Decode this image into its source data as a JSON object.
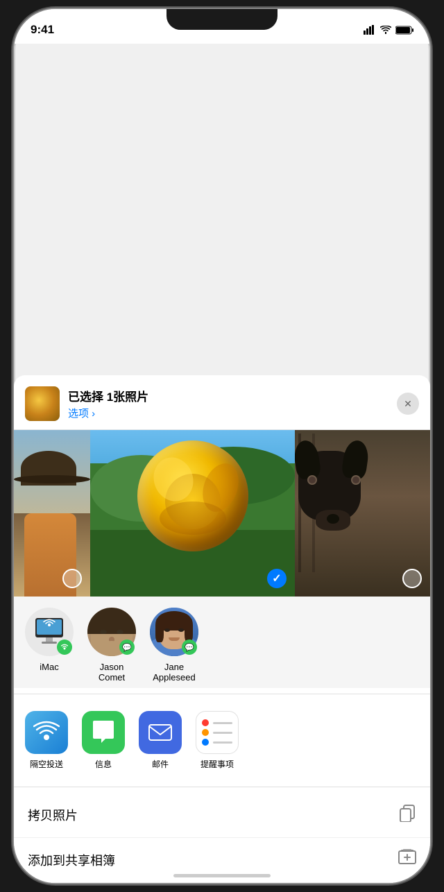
{
  "statusBar": {
    "time": "9:41"
  },
  "photoHeader": {
    "title": "已选择 1张照片",
    "options": "选项 ›",
    "closeLabel": "×"
  },
  "photos": {
    "selected": 1,
    "items": [
      {
        "id": "left",
        "type": "person-hat"
      },
      {
        "id": "center",
        "type": "yellow-rose",
        "selected": true
      },
      {
        "id": "right",
        "type": "dog"
      }
    ]
  },
  "airdrop": {
    "people": [
      {
        "id": "imac",
        "name": "iMac",
        "type": "device"
      },
      {
        "id": "jason",
        "name": "Jason\nComet",
        "nameDisplay": "Jason Comet",
        "type": "person"
      },
      {
        "id": "jane",
        "name": "Jane\nAppleseed",
        "nameDisplay": "Jane Appleseed",
        "type": "person"
      }
    ]
  },
  "apps": [
    {
      "id": "airdrop",
      "label": "隔空投送"
    },
    {
      "id": "messages",
      "label": "信息"
    },
    {
      "id": "mail",
      "label": "邮件"
    },
    {
      "id": "reminders",
      "label": "提醒事项"
    }
  ],
  "actions": [
    {
      "id": "copy-photo",
      "label": "拷贝照片"
    },
    {
      "id": "add-album",
      "label": "添加到共享相簿"
    }
  ]
}
